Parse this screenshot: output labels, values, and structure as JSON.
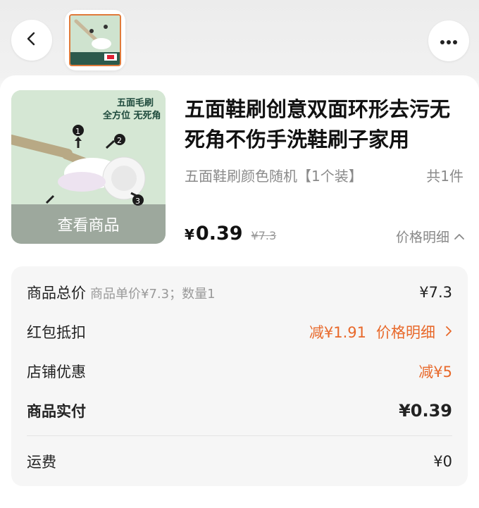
{
  "header": {
    "back_icon": "chevron-left-icon",
    "more_icon": "more-dots-icon"
  },
  "product": {
    "title": "五面鞋刷创意双面环形去污无死角不伤手洗鞋刷子家用",
    "spec": "五面鞋刷颜色随机【1个装】",
    "quantity": "共1件",
    "view_label": "查看商品",
    "image_texts": [
      "五面毛刷",
      "全方位 无死角"
    ],
    "price_currency": "¥",
    "price": "0.39",
    "original_price": "¥7.3",
    "price_detail_label": "价格明细"
  },
  "summary": {
    "total": {
      "label": "商品总价",
      "sub": "商品单价¥7.3；数量1",
      "value": "¥7.3"
    },
    "redpack": {
      "label": "红包抵扣",
      "value": "减¥1.91",
      "link": "价格明细"
    },
    "store": {
      "label": "店铺优惠",
      "value": "减¥5"
    },
    "actual": {
      "label": "商品实付",
      "value": "¥0.39"
    },
    "shipping": {
      "label": "运费",
      "value": "¥0"
    }
  },
  "colors": {
    "accent": "#e8692b",
    "image_bg": "#d7e8d6"
  }
}
